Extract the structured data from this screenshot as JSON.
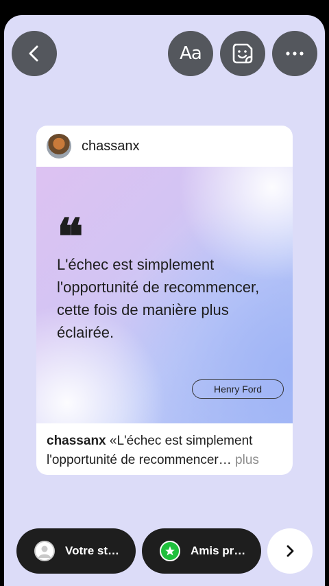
{
  "toolbar": {
    "back_icon": "chevron-left-icon",
    "text_tool_label": "Aa",
    "sticker_icon": "sticker-icon",
    "more_icon": "more-dots-icon"
  },
  "post": {
    "username": "chassanx",
    "quote": "L'échec est simplement l'opportunité de recommencer, cette fois de manière plus éclairée.",
    "author": "Henry Ford",
    "caption_user": "chassanx",
    "caption_text": " «L'échec est simplement l'opportunité de recommencer",
    "caption_ellipsis": "…",
    "caption_more": " plus"
  },
  "share": {
    "your_story_label": "Votre st…",
    "close_friends_label": "Amis pr…"
  },
  "colors": {
    "background": "#dcdcf8",
    "button_dark": "#54575d",
    "pill_dark": "#1e1e1e",
    "close_friends_green": "#1fbf3c"
  }
}
